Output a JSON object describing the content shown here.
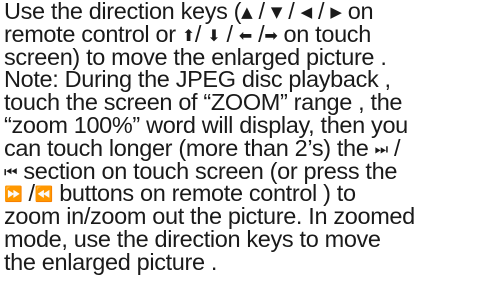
{
  "text": {
    "l1a": "Use the direction keys (",
    "l1b": " on",
    "l2a": "remote control or ",
    "l2b": " on touch",
    "l3": "screen) to move the enlarged picture .",
    "l4": "Note: During the JPEG disc playback ,",
    "l5": "touch the screen of  “ZOOM” range , the",
    "l6": "“zoom 100%”  word will display, then you",
    "l7a": "can touch longer (more than 2’s) the ",
    "l7b": " /",
    "l8a": " section on touch screen (or press the",
    "l9a": " /",
    "l9b": "  buttons on remote control )  to",
    "l10": "zoom in/zoom out the picture. In zoomed",
    "l11": "mode, use the direction keys to move",
    "l12": "the enlarged picture ."
  },
  "icons": {
    "remote_up": "▲",
    "remote_down": "▼",
    "remote_left": "◀",
    "remote_right": "▶",
    "touch_up": "⬆",
    "touch_down": "⬇",
    "touch_left": "⬅",
    "touch_right": "➡",
    "next": "⏭",
    "prev": "⏮",
    "forward": "⏩",
    "rewind": "⏪"
  }
}
